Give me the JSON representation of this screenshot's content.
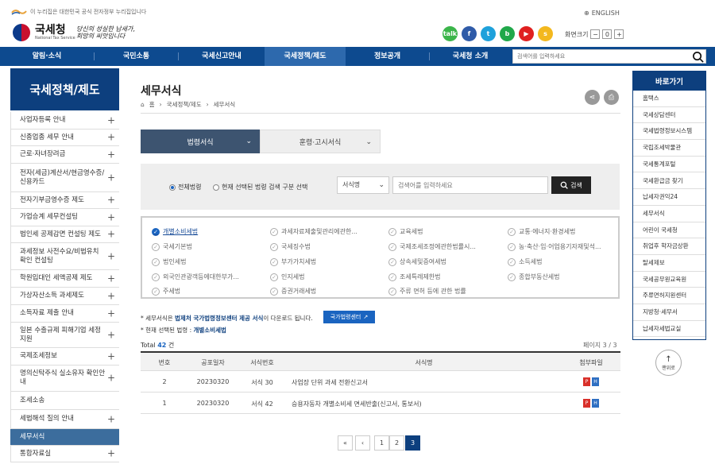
{
  "gov_banner": "이 누리집은 대한민국 공식 전자정부 누리집입니다",
  "english": "ENGLISH",
  "logo": {
    "name": "국세청",
    "sub": "National Tax Service"
  },
  "slogan": [
    "당신의 성실한 납세가,",
    "희망의 씨앗입니다"
  ],
  "sns": [
    {
      "icon": "talk-icon",
      "label": "talk",
      "color": "#3bb54a"
    },
    {
      "icon": "facebook-icon",
      "label": "f",
      "color": "#2f5ba8"
    },
    {
      "icon": "twitter-icon",
      "label": "t",
      "color": "#1ea1db"
    },
    {
      "icon": "blog-icon",
      "label": "b",
      "color": "#20a84a"
    },
    {
      "icon": "youtube-icon",
      "label": "▶",
      "color": "#e02020"
    },
    {
      "icon": "kakaostory-icon",
      "label": "s",
      "color": "#f3b81e"
    }
  ],
  "fontsize": {
    "label": "화면크기",
    "minus": "−",
    "zero": "0",
    "plus": "+"
  },
  "gnb": {
    "items": [
      "알림·소식",
      "국민소통",
      "국세신고안내",
      "국세정책/제도",
      "정보공개",
      "국세청 소개"
    ],
    "search_placeholder": "검색어를 입력하세요"
  },
  "lnb": {
    "title": "국세정책/제도",
    "items": [
      {
        "label": "사업자등록 안내",
        "plus": true
      },
      {
        "label": "신종업종 세무 안내",
        "plus": true
      },
      {
        "label": "근로·자녀장려금",
        "plus": true
      },
      {
        "label": "전자(세금)계산서/현금영수증/신용카드",
        "plus": true
      },
      {
        "label": "전자기부금영수증 제도",
        "plus": true
      },
      {
        "label": "가업승계 세무컨설팅",
        "plus": true
      },
      {
        "label": "법인세 공제감면 컨설팅 제도",
        "plus": true
      },
      {
        "label": "과세정보 사전수요/비법유치 확인 컨설팅",
        "plus": true
      },
      {
        "label": "학원입대인 세액공제 제도",
        "plus": true
      },
      {
        "label": "가상자산소득 과세제도",
        "plus": true
      },
      {
        "label": "소득자료 제출 안내",
        "plus": true
      },
      {
        "label": "일본 수출규제 피해기업 세정지원",
        "plus": true
      },
      {
        "label": "국제조세정보",
        "plus": true
      },
      {
        "label": "명의신탁주식 실소유자 확인안내",
        "plus": true
      },
      {
        "label": "조세소송",
        "plus": false
      },
      {
        "label": "세법해석 질의 안내",
        "plus": true
      },
      {
        "label": "세무서식",
        "plus": false,
        "active": true
      },
      {
        "label": "통합자료실",
        "plus": true
      }
    ]
  },
  "page": {
    "title": "세무서식",
    "breadcrumb": [
      "홈",
      "국세정책/제도",
      "세무서식"
    ]
  },
  "tabs": [
    "법령서식",
    "훈령·고시서식"
  ],
  "search": {
    "radio_all": "전체법령",
    "radio_selected": "현재 선택된 법령 검색 구분 선택",
    "select": "서식명",
    "placeholder": "검색어를 입력하세요",
    "button": "검색"
  },
  "laws": [
    {
      "label": "개별소비세법",
      "on": true
    },
    {
      "label": "과세자료제출및관리에관한..."
    },
    {
      "label": "교육세법"
    },
    {
      "label": "교통·에너지·환경세법"
    },
    {
      "label": "국세기본법"
    },
    {
      "label": "국세징수법"
    },
    {
      "label": "국제조세조정에관한법률시..."
    },
    {
      "label": "농·축산·임·어업용기자재및석..."
    },
    {
      "label": "법인세법"
    },
    {
      "label": "부가가치세법"
    },
    {
      "label": "상속세및증여세법"
    },
    {
      "label": "소득세법"
    },
    {
      "label": "외국인관광객등에대한부가..."
    },
    {
      "label": "인지세법"
    },
    {
      "label": "조세특례제한법"
    },
    {
      "label": "종합부동산세법"
    },
    {
      "label": "주세법"
    },
    {
      "label": "증권거래세법"
    },
    {
      "label": "주류 면허 등에 관한 법률"
    }
  ],
  "notes": {
    "n1_pre": "* 세무서식은 ",
    "n1_b": "법제처 국가법령정보센터 제공 서식",
    "n1_post": "이 다운로드 됩니다.",
    "law_center": "국가법령센터",
    "n2_pre": "* 현재 선택된 법령 : ",
    "n2_b": "개별소비세법"
  },
  "total": {
    "label": "Total",
    "count": "42",
    "unit": "건"
  },
  "pageinfo": "페이지 3 / 3",
  "table": {
    "headers": [
      "번호",
      "공포일자",
      "서식번호",
      "서식명",
      "첨부파일"
    ],
    "rows": [
      {
        "no": "2",
        "date": "20230320",
        "form": "서식 30",
        "name": "사업장 단위 과세 전환신고서"
      },
      {
        "no": "1",
        "date": "20230320",
        "form": "서식 42",
        "name": "승용자동차 개별소비세 면세반출(신고서, 통보서)"
      }
    ]
  },
  "pagination": [
    "«",
    "‹",
    "1",
    "2",
    "3"
  ],
  "quick": {
    "title": "바로가기",
    "items": [
      "홈택스",
      "국세상담센터",
      "국세법령정보시스템",
      "국립조세박물관",
      "국세통계포털",
      "국세환급금 찾기",
      "납세자권익24",
      "세무서식",
      "어린이 국세청",
      "취업후 학자금상환",
      "탈세제보",
      "국세공무원교육원",
      "주류면허지원센터",
      "지방청·세무서",
      "납세자세법교실"
    ]
  },
  "top_button": "맨위로"
}
